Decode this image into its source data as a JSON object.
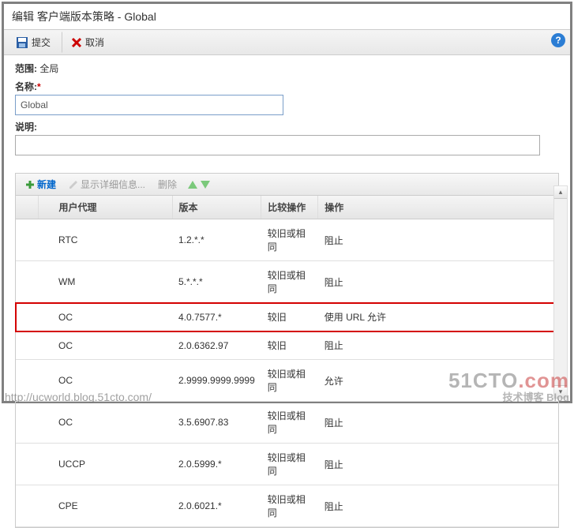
{
  "title": "编辑 客户端版本策略 - Global",
  "toolbar": {
    "submit": "提交",
    "cancel": "取消"
  },
  "form": {
    "scope_label": "范围:",
    "scope_value": "全局",
    "name_label": "名称:",
    "name_value": "Global",
    "desc_label": "说明:",
    "desc_value": ""
  },
  "table_toolbar": {
    "new": "新建",
    "details": "显示详细信息...",
    "delete": "删除"
  },
  "columns": {
    "c1": "用户代理",
    "c2": "版本",
    "c3": "比较操作",
    "c4": "操作"
  },
  "rows": [
    {
      "agent": "RTC",
      "version": "1.2.*.*",
      "compare": "较旧或相同",
      "action": "阻止",
      "hl": false
    },
    {
      "agent": "WM",
      "version": "5.*.*.*",
      "compare": "较旧或相同",
      "action": "阻止",
      "hl": false
    },
    {
      "agent": "OC",
      "version": "4.0.7577.*",
      "compare": "较旧",
      "action": "使用 URL 允许",
      "hl": true
    },
    {
      "agent": "OC",
      "version": "2.0.6362.97",
      "compare": "较旧",
      "action": "阻止",
      "hl": false
    },
    {
      "agent": "OC",
      "version": "2.9999.9999.9999",
      "compare": "较旧或相同",
      "action": "允许",
      "hl": false
    },
    {
      "agent": "OC",
      "version": "3.5.6907.83",
      "compare": "较旧或相同",
      "action": "阻止",
      "hl": false
    },
    {
      "agent": "UCCP",
      "version": "2.0.5999.*",
      "compare": "较旧或相同",
      "action": "阻止",
      "hl": false
    },
    {
      "agent": "CPE",
      "version": "2.0.6021.*",
      "compare": "较旧或相同",
      "action": "阻止",
      "hl": false
    }
  ],
  "watermark": {
    "url": "http://ucworld.blog.51cto.com/",
    "logo_main": "51CTO",
    "logo_suffix": ".com",
    "logo_sub": "技术博客  Blog"
  }
}
